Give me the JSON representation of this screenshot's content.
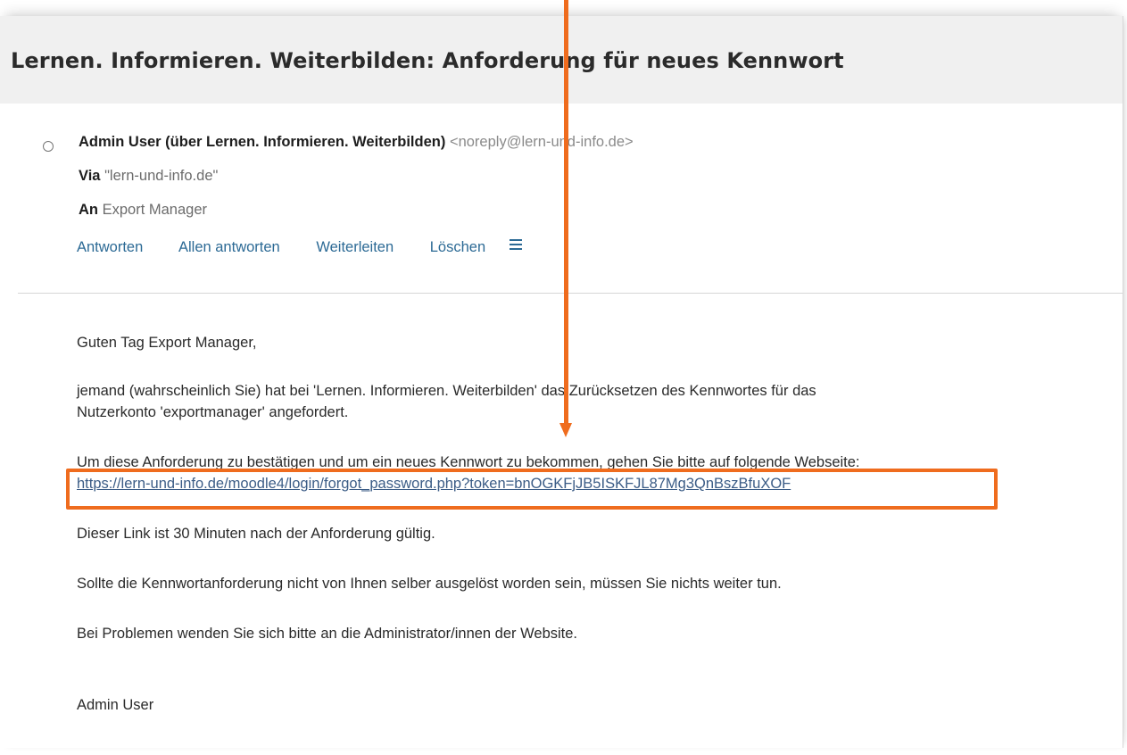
{
  "subject": "Lernen. Informieren. Weiterbilden: Anforderung für neues Kennwort",
  "header": {
    "from_name": "Admin User (über Lernen. Informieren. Weiterbilden)",
    "from_email": "<noreply@lern-und-info.de>",
    "via_label": "Via",
    "via_value": "\"lern-und-info.de\"",
    "to_label": "An",
    "to_value": "Export Manager"
  },
  "actions": {
    "reply": "Antworten",
    "reply_all": "Allen antworten",
    "forward": "Weiterleiten",
    "delete": "Löschen",
    "more_icon": "menu-icon"
  },
  "body": {
    "greeting": "Guten Tag Export Manager,",
    "p1_line1": "jemand (wahrscheinlich Sie) hat bei 'Lernen. Informieren. Weiterbilden' das Zurücksetzen des Kennwortes für das",
    "p1_line2": "Nutzerkonto 'exportmanager' angefordert.",
    "p2": "Um diese Anforderung zu bestätigen und um ein neues Kennwort zu bekommen, gehen Sie bitte auf folgende Webseite:",
    "link": "https://lern-und-info.de/moodle4/login/forgot_password.php?token=bnOGKFjJB5ISKFJL87Mg3QnBszBfuXOF",
    "p3": "Dieser Link ist 30 Minuten nach der Anforderung gültig.",
    "p4": "Sollte die Kennwortanforderung nicht von Ihnen selber ausgelöst worden sein, müssen Sie nichts weiter tun.",
    "p5": "Bei Problemen wenden Sie sich bitte an die Administrator/innen der Website.",
    "signature": "Admin User"
  },
  "annotation": {
    "color": "#ef6c1e"
  }
}
